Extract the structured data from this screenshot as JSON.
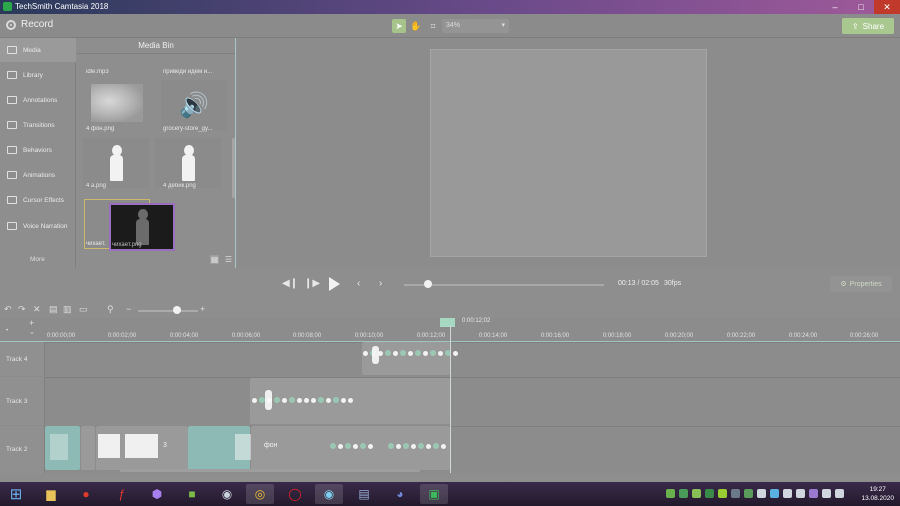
{
  "window": {
    "title": "TechSmith Camtasia 2018",
    "min": "–",
    "max": "□",
    "close": "✕"
  },
  "toolbar": {
    "record_label": "Record",
    "zoom": "34%",
    "share_label": "Share"
  },
  "nav": {
    "items": [
      {
        "label": "Media",
        "icon": "film-icon"
      },
      {
        "label": "Library",
        "icon": "library-icon"
      },
      {
        "label": "Annotations",
        "icon": "annotation-icon"
      },
      {
        "label": "Transitions",
        "icon": "transition-icon"
      },
      {
        "label": "Behaviors",
        "icon": "behavior-icon"
      },
      {
        "label": "Animations",
        "icon": "animation-icon"
      },
      {
        "label": "Cursor Effects",
        "icon": "cursor-icon"
      },
      {
        "label": "Voice Narration",
        "icon": "microphone-icon"
      }
    ],
    "more_label": "More",
    "add_label": "+"
  },
  "media_bin": {
    "title": "Media Bin",
    "items": [
      {
        "label": "idle.mp3"
      },
      {
        "label": "приведи идем и..."
      },
      {
        "label": "4 фон.png"
      },
      {
        "label": "grocery-store_gy..."
      },
      {
        "label": "4 a.png"
      },
      {
        "label": "4 дебик.png"
      },
      {
        "label": "чихает.png"
      }
    ],
    "drag_label": "чихает.png"
  },
  "playback": {
    "timecode": "00:13 / 02:05",
    "fps": "30fps",
    "properties_label": "Properties",
    "progress_fraction": 0.1
  },
  "timeline": {
    "playhead": "0:00:12;02",
    "ruler_ticks": [
      "0:00:00;00",
      "0:00:02;00",
      "0:00:04;00",
      "0:00:06;00",
      "0:00:08;00",
      "0:00:10;00",
      "0:00:12;00",
      "0:00:14;00",
      "0:00:16;00",
      "0:00:18;00",
      "0:00:20;00",
      "0:00:22;00",
      "0:00:24;00",
      "0:00:26;00"
    ],
    "tracks": [
      {
        "label": "Track 4"
      },
      {
        "label": "Track 3"
      },
      {
        "label": "Track 2"
      }
    ],
    "clip_text_3": "3",
    "clip_text_fon": "фон"
  },
  "taskbar": {
    "time": "19:27",
    "date": "13.08.2020"
  },
  "colors": {
    "accent": "#a9c890",
    "teal": "#8dbab4",
    "selection": "#9b6fbf"
  }
}
